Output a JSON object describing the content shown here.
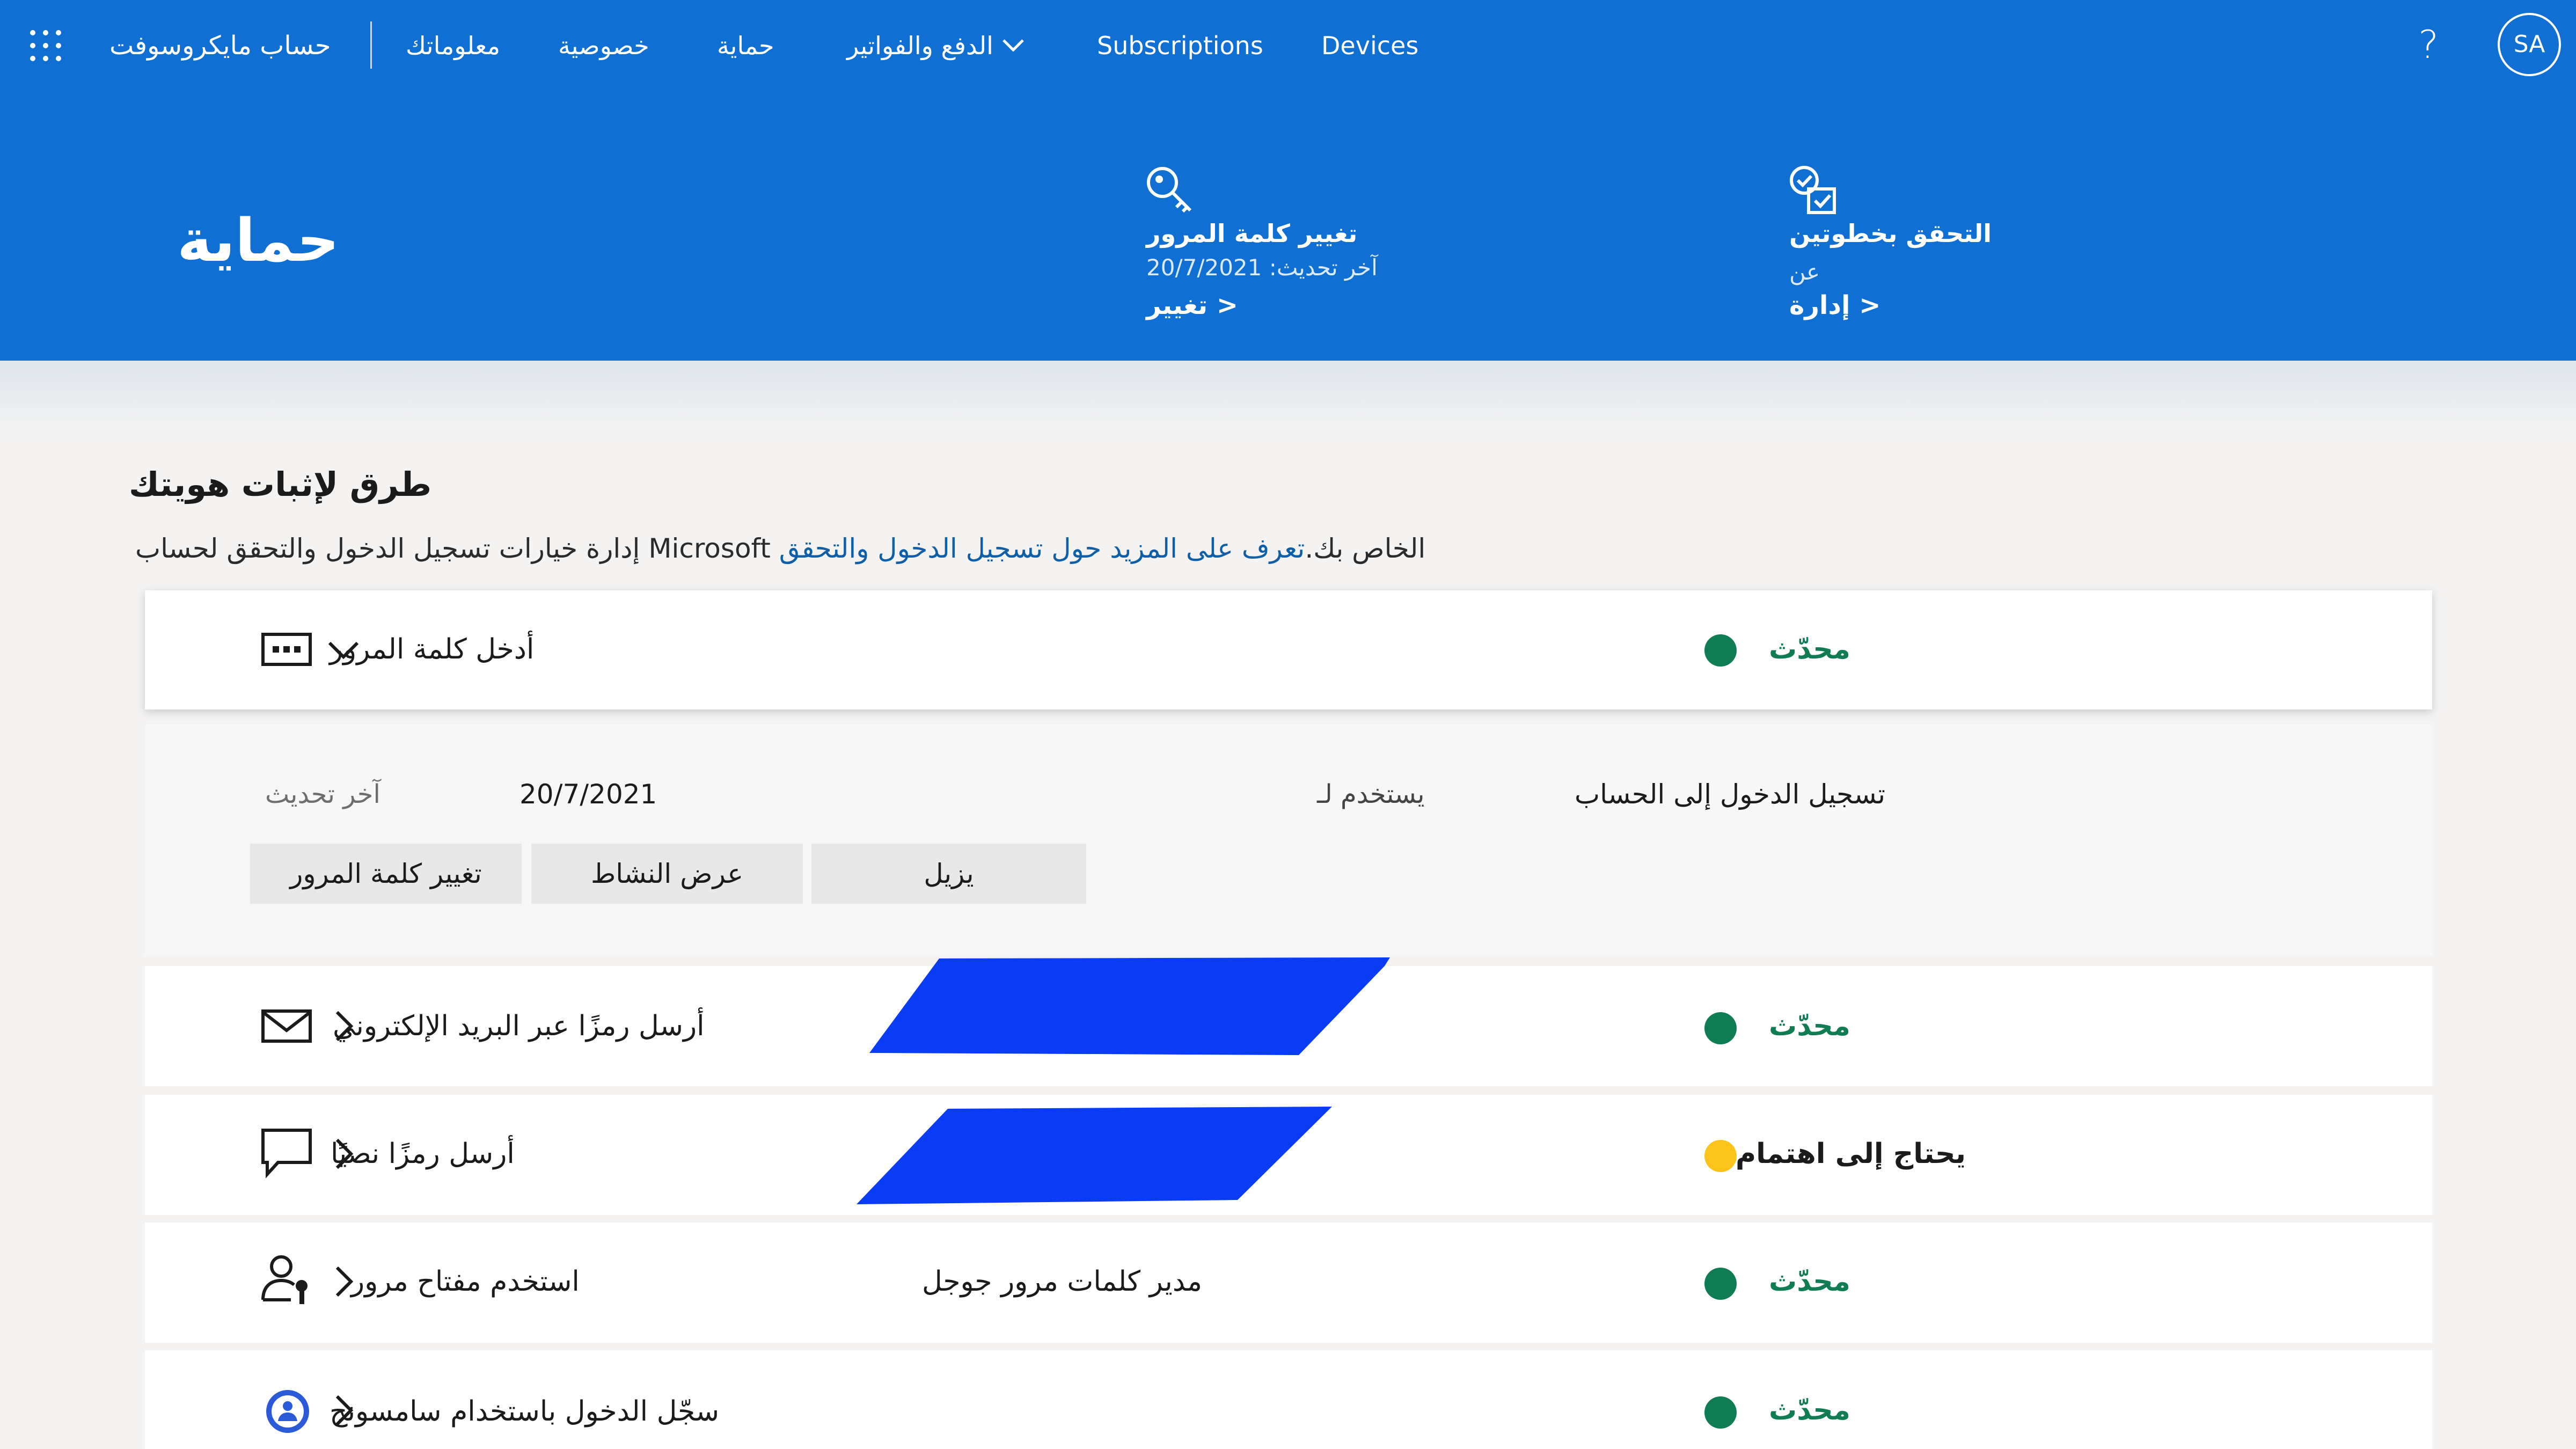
{
  "nav": {
    "brand": "حساب مايكروسوفت",
    "items": [
      {
        "label": "معلوماتك"
      },
      {
        "label": "خصوصية"
      },
      {
        "label": "حماية"
      },
      {
        "label": "الدفع والفواتير"
      },
      {
        "label": "Subscriptions"
      },
      {
        "label": "Devices"
      }
    ],
    "help": "?",
    "avatar_initials": "SA"
  },
  "header": {
    "title": "حماية",
    "change_password": {
      "title": "تغيير كلمة المرور",
      "subtitle": "آخر تحديث: 20/7/2021",
      "link": "تغيير >"
    },
    "two_step": {
      "title": "التحقق بخطوتين",
      "subtitle": "عن",
      "link": "إدارة >"
    }
  },
  "section": {
    "title": "طرق لإثبات هويتك",
    "description": "إدارة خيارات تسجيل الدخول والتحقق لحساب Microsoft الخاص بك.",
    "learn_more": "تعرف على المزيد حول تسجيل الدخول والتحقق"
  },
  "methods": [
    {
      "label": "أدخل كلمة المرور",
      "status": "محدّث",
      "state": "ok",
      "icon": "password-dots-icon",
      "expanded": true
    },
    {
      "label": "أرسل رمزًا عبر البريد الإلكتروني",
      "status": "محدّث",
      "state": "ok",
      "icon": "envelope-icon",
      "detail": ""
    },
    {
      "label": "أرسل رمزًا نصيًا",
      "status": "يحتاج إلى اهتمام",
      "state": "warn",
      "icon": "chat-bubble-icon",
      "detail": ""
    },
    {
      "label": "استخدم مفتاح مرور",
      "status": "محدّث",
      "state": "ok",
      "icon": "passkey-person-icon",
      "detail": "مدير كلمات مرور جوجل"
    },
    {
      "label": "سجّل الدخول باستخدام سامسونج",
      "status": "محدّث",
      "state": "ok",
      "icon": "samsung-account-icon",
      "detail": ""
    }
  ],
  "password_details": {
    "used_for_label": "يستخدم لـ",
    "used_for_value": "تسجيل الدخول إلى الحساب",
    "last_updated_label": "آخر تحديث",
    "last_updated_value": "20/7/2021",
    "buttons": {
      "remove": "يزيل",
      "view_activity": "عرض النشاط",
      "change_password": "تغيير كلمة المرور"
    }
  },
  "colors": {
    "header_blue": "#0f6fd3",
    "ok_green": "#107c54",
    "warn_yellow": "#fcc31a",
    "link_blue": "#0f5ea8",
    "redaction_blue": "#0a3bf5"
  }
}
